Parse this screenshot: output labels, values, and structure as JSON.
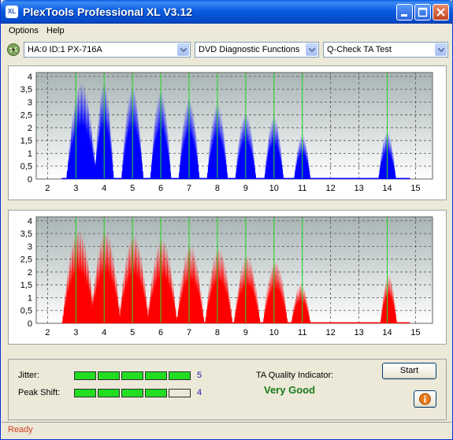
{
  "window": {
    "title": "PlexTools Professional XL V3.12",
    "icon_text": "XL"
  },
  "menu": [
    {
      "label": "Options"
    },
    {
      "label": "Help"
    }
  ],
  "toolbar": {
    "drive": "HA:0 ID:1  PX-716A",
    "function": "DVD Diagnostic Functions",
    "test": "Q-Check TA Test"
  },
  "charts": {
    "x_ticks": [
      "2",
      "3",
      "4",
      "5",
      "6",
      "7",
      "8",
      "9",
      "10",
      "11",
      "12",
      "13",
      "14",
      "15"
    ],
    "y_ticks": [
      "4",
      "3,5",
      "3",
      "2,5",
      "2",
      "1,5",
      "1",
      "0,5",
      "0"
    ]
  },
  "chart_data": [
    {
      "type": "area",
      "name": "top",
      "color": "#0000ff",
      "xlim": [
        1.6,
        15.6
      ],
      "ylim": [
        0,
        4.15
      ],
      "peaks": [
        {
          "x": 3.2,
          "height": 3.75,
          "width": 0.55
        },
        {
          "x": 4.0,
          "height": 3.75,
          "width": 0.35
        },
        {
          "x": 5.0,
          "height": 3.6,
          "width": 0.4
        },
        {
          "x": 6.0,
          "height": 3.45,
          "width": 0.38
        },
        {
          "x": 7.0,
          "height": 3.15,
          "width": 0.38
        },
        {
          "x": 8.0,
          "height": 2.95,
          "width": 0.38
        },
        {
          "x": 9.0,
          "height": 2.6,
          "width": 0.38
        },
        {
          "x": 10.0,
          "height": 2.45,
          "width": 0.35
        },
        {
          "x": 11.0,
          "height": 1.75,
          "width": 0.3
        },
        {
          "x": 14.0,
          "height": 1.85,
          "width": 0.32
        }
      ],
      "markers": [
        3,
        4,
        5,
        6,
        7,
        8,
        9,
        10,
        11,
        14
      ]
    },
    {
      "type": "area",
      "name": "bottom",
      "color": "#ff0000",
      "xlim": [
        1.6,
        15.6
      ],
      "ylim": [
        0,
        4.15
      ],
      "peaks": [
        {
          "x": 3.1,
          "height": 3.65,
          "width": 0.6
        },
        {
          "x": 4.05,
          "height": 3.6,
          "width": 0.55
        },
        {
          "x": 5.05,
          "height": 3.45,
          "width": 0.55
        },
        {
          "x": 6.05,
          "height": 3.3,
          "width": 0.55
        },
        {
          "x": 7.05,
          "height": 3.05,
          "width": 0.5
        },
        {
          "x": 8.05,
          "height": 2.95,
          "width": 0.5
        },
        {
          "x": 9.05,
          "height": 2.65,
          "width": 0.48
        },
        {
          "x": 10.05,
          "height": 2.45,
          "width": 0.45
        },
        {
          "x": 10.95,
          "height": 1.55,
          "width": 0.35
        },
        {
          "x": 14.05,
          "height": 1.9,
          "width": 0.3
        }
      ],
      "markers": [
        3,
        4,
        5,
        6,
        7,
        8,
        9,
        10,
        11,
        14
      ]
    }
  ],
  "results": {
    "jitter_label": "Jitter:",
    "jitter_value": "5",
    "jitter_level": 5,
    "peak_label": "Peak Shift:",
    "peak_value": "4",
    "peak_level": 4,
    "ta_label": "TA Quality Indicator:",
    "ta_result": "Very Good"
  },
  "buttons": {
    "start": "Start"
  },
  "status": {
    "text": "Ready"
  }
}
